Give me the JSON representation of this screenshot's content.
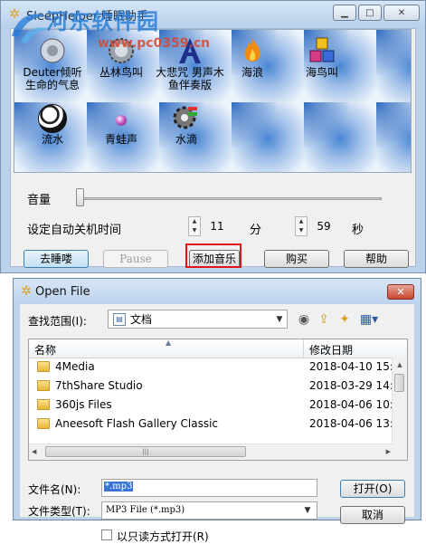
{
  "sleep_window": {
    "title": "SleepHelper-睡眠助手",
    "sounds": [
      {
        "label": "Deuter倾听生命的气息",
        "icon": "globe-icon"
      },
      {
        "label": "丛林鸟叫",
        "icon": "gear-globe-icon"
      },
      {
        "label": "大悲咒 男声木鱼伴奏版",
        "icon": "letter-a-icon"
      },
      {
        "label": "海浪",
        "icon": "flame-icon"
      },
      {
        "label": "海鸟叫",
        "icon": "cubes-icon"
      },
      {
        "label": "流水",
        "icon": "soccer-ball-icon"
      },
      {
        "label": "青蛙声",
        "icon": "bead-icon"
      },
      {
        "label": "水滴",
        "icon": "gear-tool-icon"
      }
    ],
    "volume_label": "音量",
    "volume_level": 0.0,
    "shutdown_label": "设定自动关机时间",
    "minutes_value": "11",
    "minutes_unit": "分",
    "seconds_value": "59",
    "seconds_unit": "秒",
    "buttons": {
      "sleep": "去睡喽",
      "pause": "Pause",
      "add_music": "添加音乐",
      "buy": "购买",
      "help": "帮助"
    },
    "highlight_color": "#e0141a"
  },
  "watermark": {
    "name": "河东软件园",
    "url": "www.pc0359.cn"
  },
  "open_dialog": {
    "title": "Open File",
    "look_in_label": "查找范围(I):",
    "look_in_value": "文档",
    "columns": {
      "name": "名称",
      "date": "修改日期"
    },
    "rows": [
      {
        "name": "4Media",
        "date": "2018-04-10 15:1"
      },
      {
        "name": "7thShare Studio",
        "date": "2018-03-29 14:4"
      },
      {
        "name": "360js Files",
        "date": "2018-04-06 10:4"
      },
      {
        "name": "Aneesoft Flash Gallery Classic",
        "date": "2018-04-06 13:"
      }
    ],
    "filename_label": "文件名(N):",
    "filename_value": "*.mp3",
    "filetype_label": "文件类型(T):",
    "filetype_value": "MP3 File (*.mp3)",
    "readonly_label": "以只读方式打开(R)",
    "open_button": "打开(O)",
    "cancel_button": "取消"
  }
}
